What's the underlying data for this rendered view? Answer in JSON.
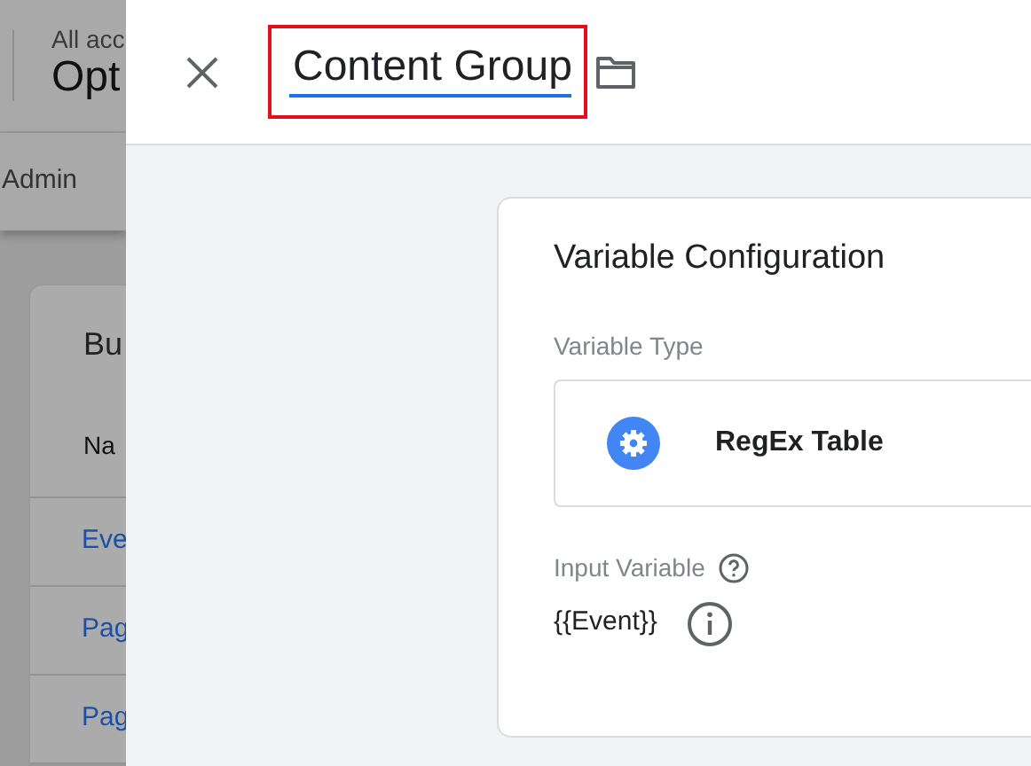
{
  "background_page": {
    "breadcrumb": "All acc",
    "container_name": "Opt",
    "nav_item": "Admin",
    "card_title": "Bu",
    "column_header": "Na",
    "rows": [
      "Eve",
      "Pag",
      "Pag"
    ]
  },
  "panel": {
    "title": "Content Group",
    "title_highlighted": true
  },
  "card": {
    "title": "Variable Configuration",
    "variable_type_label": "Variable Type",
    "variable_type": "RegEx Table",
    "input_variable_label": "Input Variable",
    "input_variable": "{{Event}}"
  }
}
